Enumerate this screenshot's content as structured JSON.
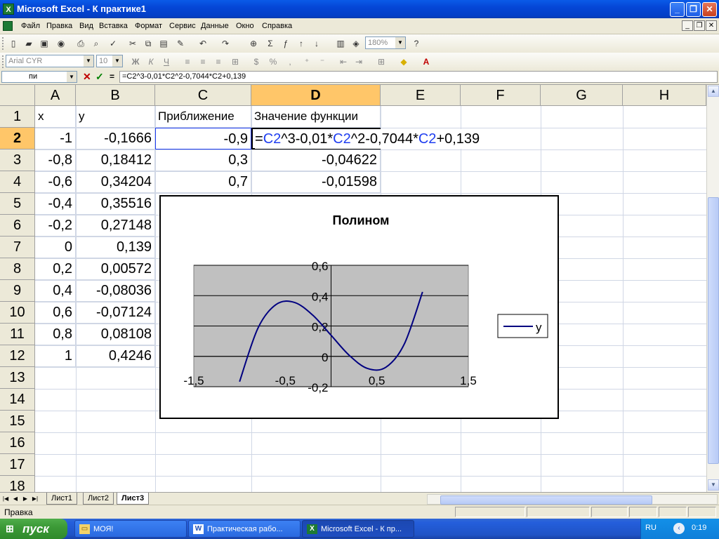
{
  "window": {
    "title": "Microsoft Excel - К практике1"
  },
  "menu": [
    "Файл",
    "Правка",
    "Вид",
    "Вставка",
    "Формат",
    "Сервис",
    "Данные",
    "Окно",
    "Справка"
  ],
  "toolbar": {
    "zoom": "180%",
    "font_name": "Arial CYR",
    "font_size": "10"
  },
  "formula_bar": {
    "name_box": "пи",
    "cancel": "✕",
    "enter": "✓",
    "equals": "=",
    "formula": "=C2^3-0,01*C2^2-0,7044*C2+0,139"
  },
  "columns": [
    "A",
    "B",
    "C",
    "D",
    "E",
    "F",
    "G",
    "H"
  ],
  "rows": [
    "1",
    "2",
    "3",
    "4",
    "5",
    "6",
    "7",
    "8",
    "9",
    "10",
    "11",
    "12",
    "13",
    "14",
    "15",
    "16",
    "17",
    "18"
  ],
  "cells": {
    "A1": "x",
    "B1": "y",
    "C1": "Приближение",
    "D1": "Значение функции",
    "A2": "-1",
    "B2": "-0,1666",
    "C2": "-0,9",
    "A3": "-0,8",
    "B3": "0,18412",
    "C3": "0,3",
    "D3": "-0,04622",
    "A4": "-0,6",
    "B4": "0,34204",
    "C4": "0,7",
    "D4": "-0,01598",
    "A5": "-0,4",
    "B5": "0,35516",
    "A6": "-0,2",
    "B6": "0,27148",
    "A7": "0",
    "B7": "0,139",
    "A8": "0,2",
    "B8": "0,00572",
    "A9": "0,4",
    "B9": "-0,08036",
    "A10": "0,6",
    "B10": "-0,07124",
    "A11": "0,8",
    "B11": "0,08108",
    "A12": "1",
    "B12": "0,4246"
  },
  "edit_formula_parts": [
    "=",
    "C2",
    "^3-0,01",
    "*",
    "C2",
    "^2-0,7044*",
    "C2",
    "+0,139"
  ],
  "chart_data": {
    "type": "line",
    "title": "Полином",
    "x": [
      -1,
      -0.8,
      -0.6,
      -0.4,
      -0.2,
      0,
      0.2,
      0.4,
      0.6,
      0.8,
      1
    ],
    "series": [
      {
        "name": "y",
        "values": [
          -0.1666,
          0.18412,
          0.34204,
          0.35516,
          0.27148,
          0.139,
          0.00572,
          -0.08036,
          -0.07124,
          0.08108,
          0.4246
        ]
      }
    ],
    "xlim": [
      -1.5,
      1.5
    ],
    "ylim": [
      -0.2,
      0.6
    ],
    "x_ticks": [
      "-1,5",
      "-0,5",
      "0,5",
      "1,5"
    ],
    "y_ticks": [
      "0,6",
      "0,4",
      "0,2",
      "0",
      "-0,2"
    ],
    "legend_position": "right",
    "colors": {
      "plot_bg": "#c0c0c0",
      "line": "#000080"
    }
  },
  "sheets": [
    "Лист1",
    "Лист2",
    "Лист3"
  ],
  "status": {
    "mode": "Правка"
  },
  "taskbar": {
    "start": "пуск",
    "tasks": [
      "МОЯ!",
      "Практическая рабо...",
      "Microsoft Excel - К пр..."
    ],
    "lang": "RU",
    "clock": "0:19"
  }
}
